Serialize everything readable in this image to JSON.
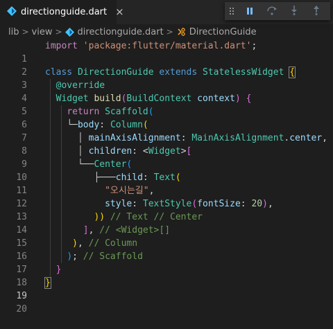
{
  "tab": {
    "filename": "directionguide.dart",
    "close": "×"
  },
  "debug_toolbar": {
    "grip": "grip-icon",
    "buttons": [
      {
        "name": "pause",
        "icon": "pause-icon"
      },
      {
        "name": "step-over",
        "icon": "step-over-icon"
      },
      {
        "name": "step-into",
        "icon": "step-into-icon"
      },
      {
        "name": "step-out",
        "icon": "step-out-icon"
      }
    ]
  },
  "breadcrumb": {
    "items": [
      "lib",
      "view",
      "directionguide.dart",
      "DirectionGuide"
    ],
    "separator": ">"
  },
  "editor": {
    "active_line": 19,
    "line_numbers": [
      "1",
      "2",
      "3",
      "4",
      "5",
      "6",
      "7",
      "8",
      "9",
      "10",
      "11",
      "12",
      "13",
      "14",
      "15",
      "16",
      "17",
      "18",
      "19",
      "20"
    ],
    "tokens": {
      "l1_import": "import",
      "l1_str": "'package:flutter/material.dart'",
      "l1_semi": ";",
      "l3_class": "class",
      "l3_name": "DirectionGuide",
      "l3_extends": "extends",
      "l3_super": "StatelessWidget",
      "l3_brace": "{",
      "l4_anno": "@override",
      "l5_widget": "Widget",
      "l5_build": "build",
      "l5_open": "(",
      "l5_ctx_type": "BuildContext",
      "l5_ctx": " context",
      "l5_close": ")",
      "l5_brace": " {",
      "l6_return": "return",
      "l6_scaffold": "Scaffold",
      "l6_paren": "(",
      "l7_guide": "└─",
      "l7_body": "body",
      "l7_colon": ": ",
      "l7_column": "Column",
      "l7_paren": "(",
      "l8_guide": "│",
      "l8_prop": "mainAxisAlignment",
      "l8_colon": ": ",
      "l8_type": "MainAxisAlignment",
      "l8_dot": ".",
      "l8_val": "center",
      "l8_comma": ",",
      "l9_guide": "│",
      "l9_prop": "children",
      "l9_colon": ": <",
      "l9_widget": "Widget",
      "l9_gt": ">",
      "l9_bracket": "[",
      "l10_guide": "└──",
      "l10_center": "Center",
      "l10_paren": "(",
      "l11_guide": "├───",
      "l11_child": "child",
      "l11_colon": ": ",
      "l11_text": "Text",
      "l11_paren": "(",
      "l12_str": "\"오시는길\"",
      "l12_comma": ",",
      "l13_style": "style",
      "l13_colon": ": ",
      "l13_textstyle": "TextStyle",
      "l13_open": "(",
      "l13_fontsize": "fontSize",
      "l13_colon2": ": ",
      "l13_num": "20",
      "l13_close": ")",
      "l13_comma": ",",
      "l14_close": "))",
      "l14_comment": " // Text // Center",
      "l15_bracket": "]",
      "l15_comma": ", ",
      "l15_comment": "// <Widget>[]",
      "l16_paren": ")",
      "l16_comma": ", ",
      "l16_comment": "// Column",
      "l17_paren": ")",
      "l17_semi": "; ",
      "l17_comment": "// Scaffold",
      "l18_brace": "}",
      "l19_brace": "}"
    }
  }
}
